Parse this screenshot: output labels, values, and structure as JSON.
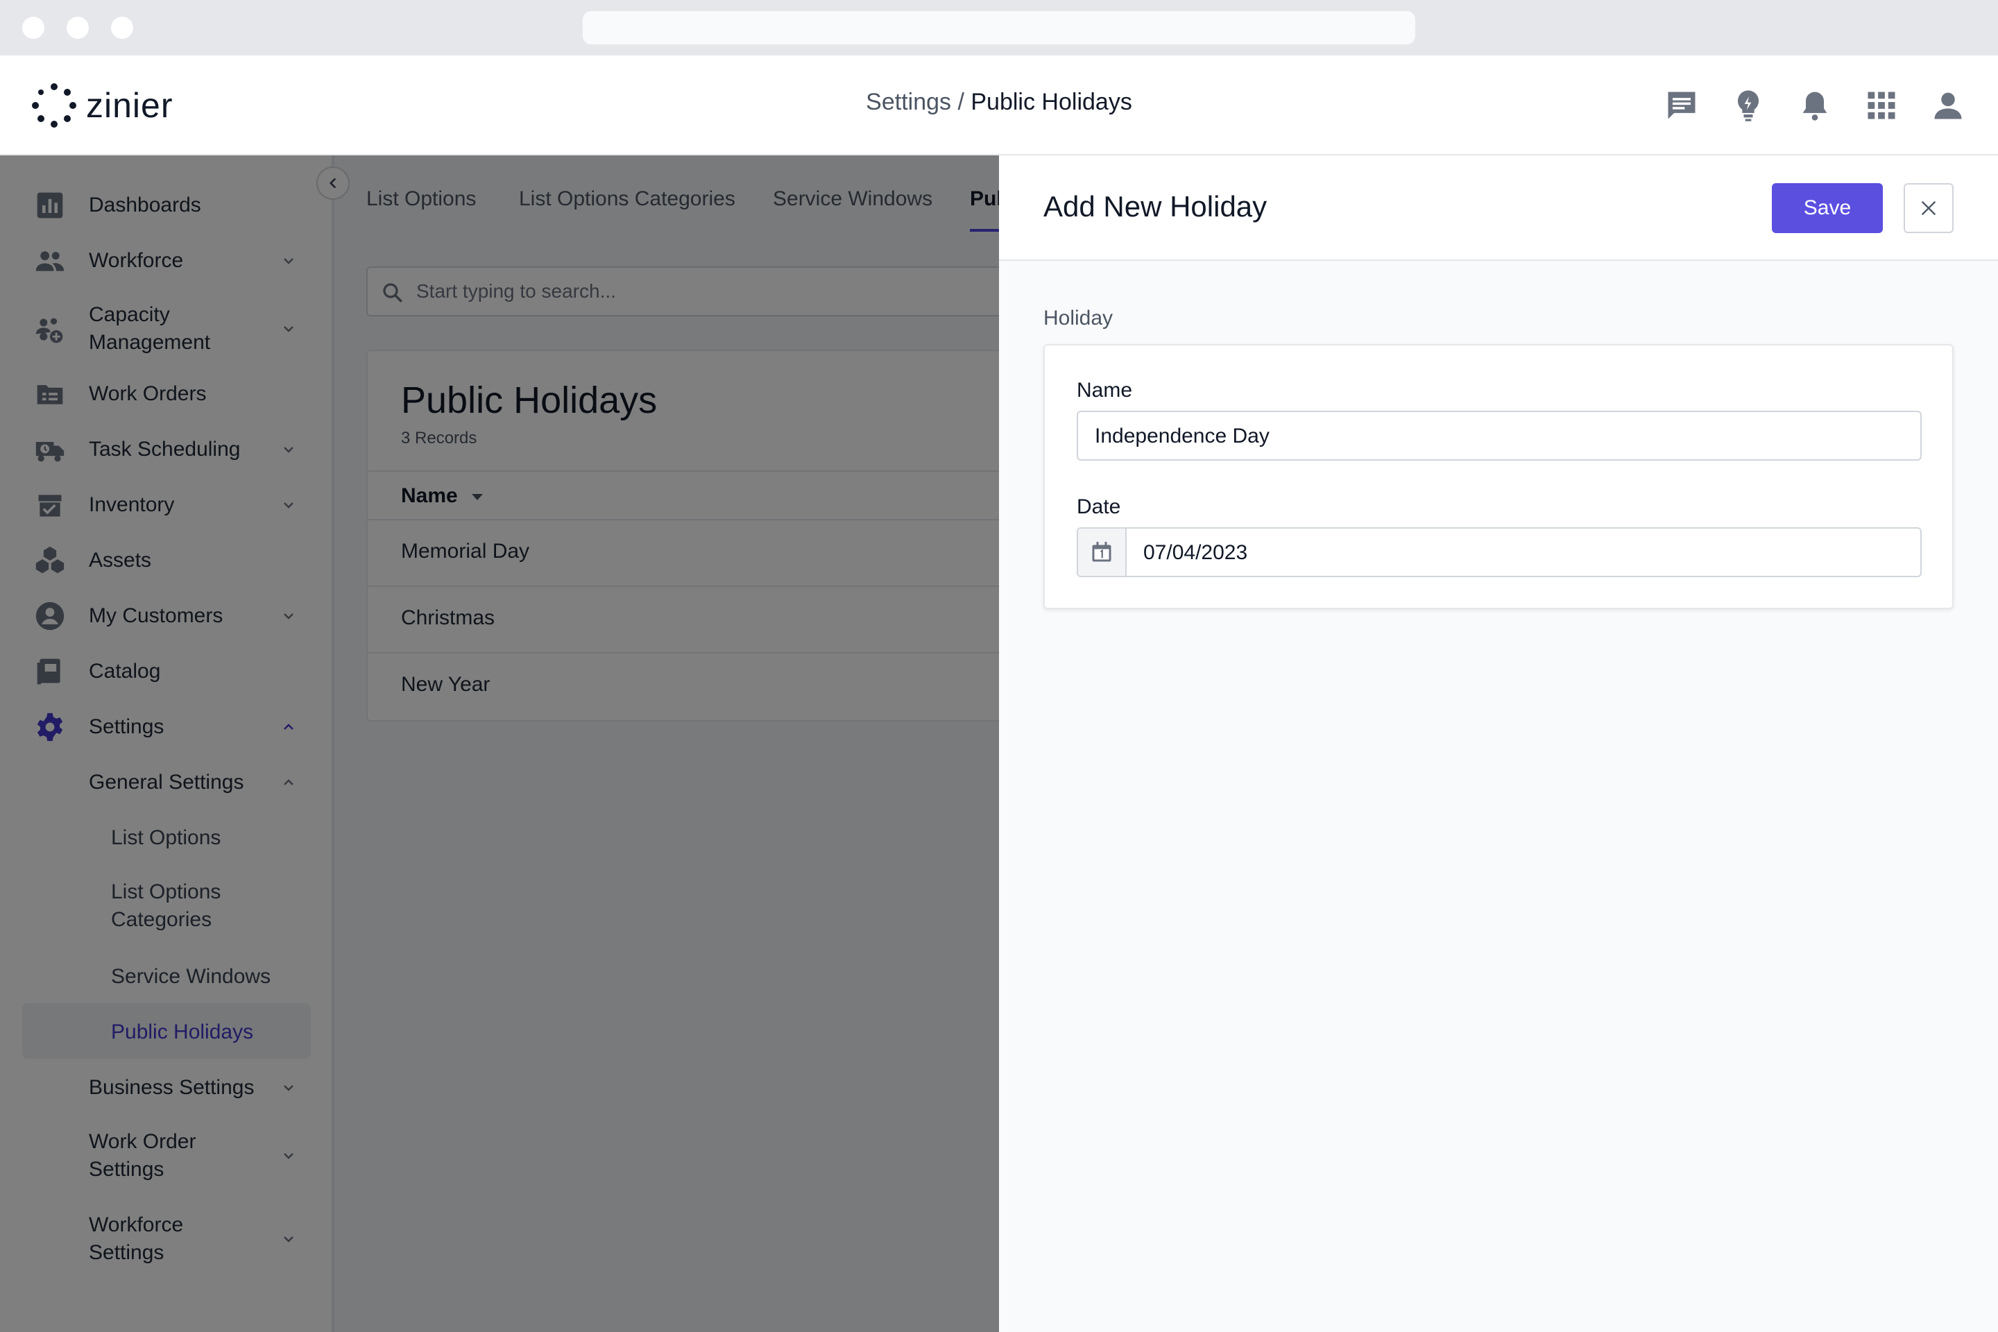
{
  "brand": {
    "name": "zinier"
  },
  "header": {
    "breadcrumb_parent": "Settings",
    "breadcrumb_separator": " / ",
    "breadcrumb_current": "Public Holidays",
    "icons": [
      "chat-icon",
      "lightbulb-icon",
      "bell-icon",
      "apps-grid-icon",
      "user-icon"
    ]
  },
  "sidebar": {
    "items": [
      {
        "label": "Dashboards",
        "icon": "bar-chart-icon"
      },
      {
        "label": "Workforce",
        "icon": "people-icon"
      },
      {
        "label": "Capacity\nManagement",
        "icon": "capacity-icon"
      },
      {
        "label": "Work Orders",
        "icon": "work-orders-icon"
      },
      {
        "label": "Task Scheduling",
        "icon": "truck-clock-icon"
      },
      {
        "label": "Inventory",
        "icon": "inventory-icon"
      },
      {
        "label": "Assets",
        "icon": "cubes-icon"
      },
      {
        "label": "My Customers",
        "icon": "customer-icon"
      },
      {
        "label": "Catalog",
        "icon": "book-icon"
      },
      {
        "label": "Settings",
        "icon": "gear-icon"
      }
    ],
    "settings_sub": {
      "general": "General Settings",
      "general_items": [
        "List Options",
        "List Options\nCategories",
        "Service Windows",
        "Public Holidays"
      ],
      "business": "Business Settings",
      "work_order": "Work Order\nSettings",
      "workforce": "Workforce\nSettings"
    }
  },
  "tabs": [
    "List Options",
    "List Options Categories",
    "Service Windows",
    "Pul"
  ],
  "search": {
    "placeholder": "Start typing to search..."
  },
  "table": {
    "title": "Public Holidays",
    "count": "3 Records",
    "column": "Name",
    "rows": [
      "Memorial Day",
      "Christmas",
      "New Year"
    ]
  },
  "drawer": {
    "title": "Add New Holiday",
    "save_label": "Save",
    "section": "Holiday",
    "name_label": "Name",
    "name_value": "Independence Day",
    "date_label": "Date",
    "date_value": "07/04/2023"
  },
  "colors": {
    "accent": "#5b4fe0",
    "active_text": "#4338ca",
    "overlay": "#000000"
  }
}
